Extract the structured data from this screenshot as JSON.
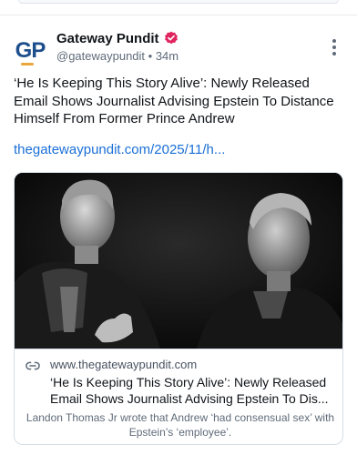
{
  "post": {
    "author_name": "Gateway Pundit",
    "avatar_text": "GP",
    "handle": "@gatewaypundit",
    "separator": " • ",
    "time": "34m",
    "text": "‘He Is Keeping This Story Alive’: Newly Released Email Shows Journalist Advising Epstein To Distance Himself From Former Prince Andrew",
    "link": "thegatewaypundit.com/2025/11/h...",
    "verified_color": "#e0245e"
  },
  "card": {
    "domain": "www.thegatewaypundit.com",
    "title": "‘He Is Keeping This Story Alive’: Newly Released Email Shows Journalist Advising Epstein To Dis...",
    "description": "Landon Thomas Jr wrote that Andrew ‘had consensual sex’ with Epstein’s ‘employee’."
  },
  "icons": {
    "verified": "verified-badge-icon",
    "more": "more-options-icon",
    "link": "link-icon"
  },
  "colors": {
    "link": "#1a6fd6",
    "avatar_primary": "#1d4f8c",
    "avatar_accent": "#e8a73a"
  }
}
